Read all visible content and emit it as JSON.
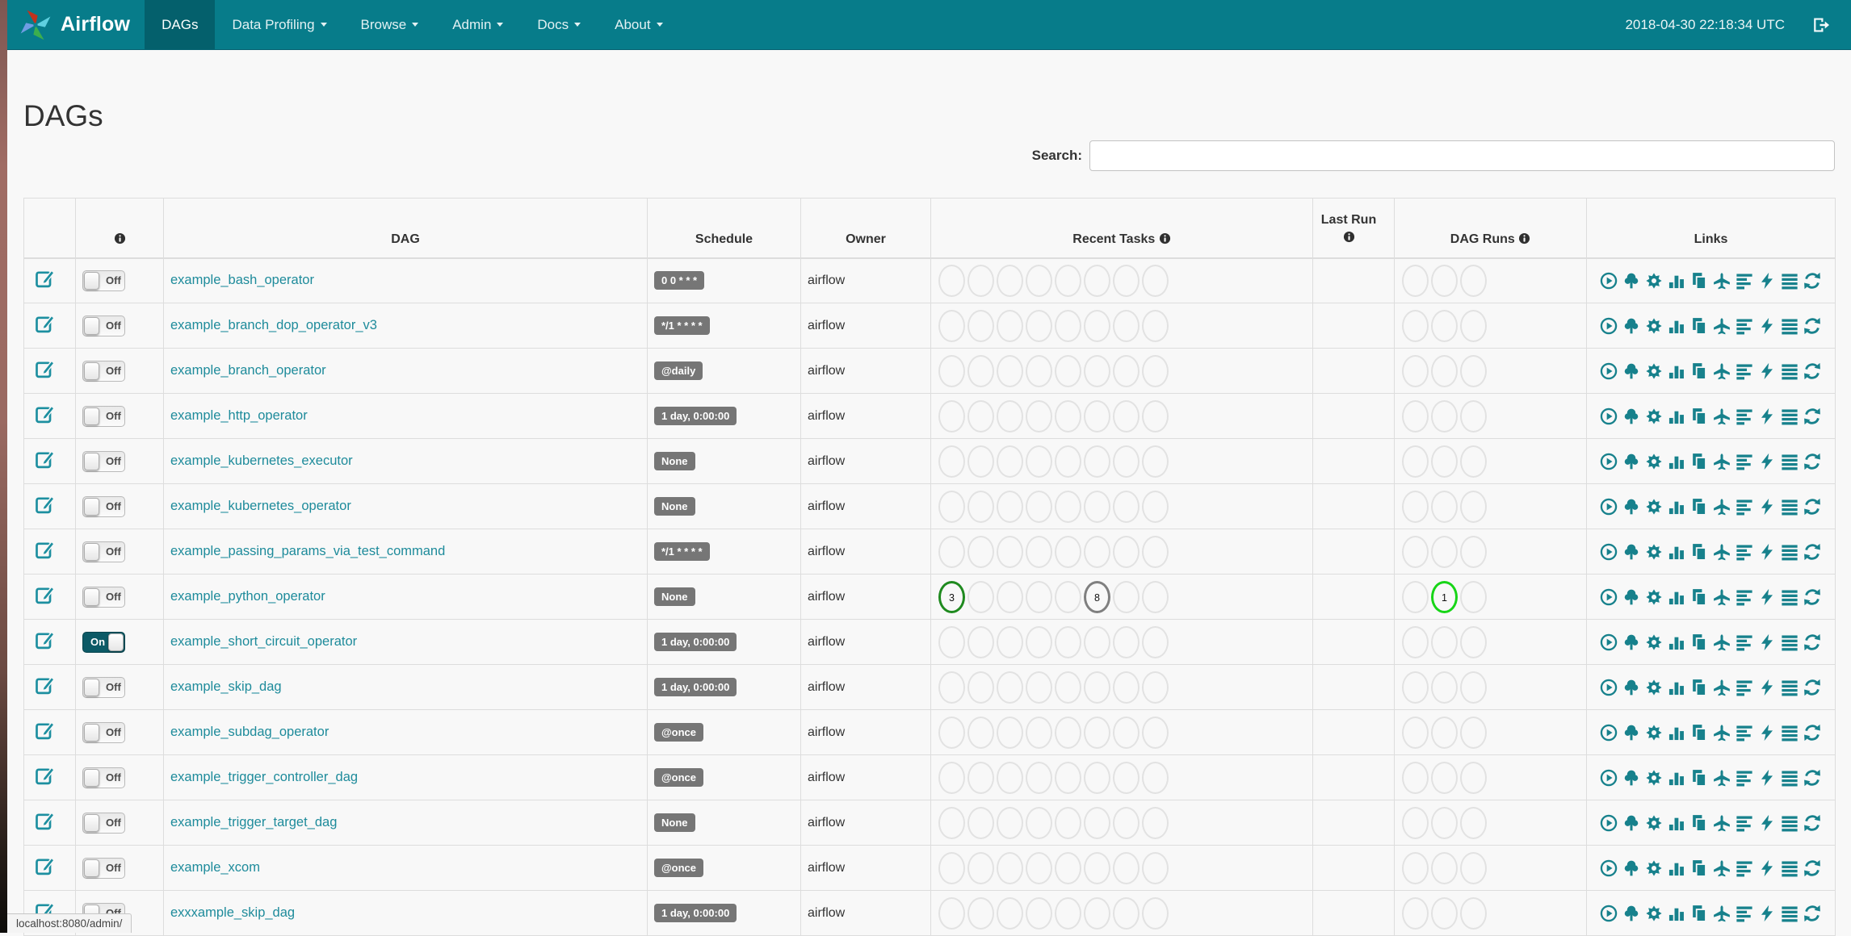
{
  "navbar": {
    "brand": "Airflow",
    "items": [
      {
        "label": "DAGs",
        "active": true,
        "caret": false
      },
      {
        "label": "Data Profiling",
        "active": false,
        "caret": true
      },
      {
        "label": "Browse",
        "active": false,
        "caret": true
      },
      {
        "label": "Admin",
        "active": false,
        "caret": true
      },
      {
        "label": "Docs",
        "active": false,
        "caret": true
      },
      {
        "label": "About",
        "active": false,
        "caret": true
      }
    ],
    "clock": "2018-04-30 22:18:34 UTC"
  },
  "page": {
    "title": "DAGs"
  },
  "search": {
    "label": "Search:",
    "value": "",
    "placeholder": ""
  },
  "table": {
    "headers": {
      "dag": "DAG",
      "schedule": "Schedule",
      "owner": "Owner",
      "recent_tasks": "Recent Tasks",
      "last_run": "Last Run",
      "dag_runs": "DAG Runs",
      "links": "Links"
    },
    "recent_task_slots": 8,
    "dag_run_slots": 3,
    "links": [
      "trigger-dag",
      "tree-view",
      "graph-view",
      "task-duration",
      "task-tries",
      "landing-times",
      "gantt-view",
      "code-view",
      "log-view",
      "refresh"
    ],
    "rows": [
      {
        "dag_id": "example_bash_operator",
        "toggle": "Off",
        "schedule": "0 0 * * *",
        "owner": "airflow",
        "last_run": ""
      },
      {
        "dag_id": "example_branch_dop_operator_v3",
        "toggle": "Off",
        "schedule": "*/1 * * * *",
        "owner": "airflow",
        "last_run": ""
      },
      {
        "dag_id": "example_branch_operator",
        "toggle": "Off",
        "schedule": "@daily",
        "owner": "airflow",
        "last_run": ""
      },
      {
        "dag_id": "example_http_operator",
        "toggle": "Off",
        "schedule": "1 day, 0:00:00",
        "owner": "airflow",
        "last_run": ""
      },
      {
        "dag_id": "example_kubernetes_executor",
        "toggle": "Off",
        "schedule": "None",
        "owner": "airflow",
        "last_run": ""
      },
      {
        "dag_id": "example_kubernetes_operator",
        "toggle": "Off",
        "schedule": "None",
        "owner": "airflow",
        "last_run": ""
      },
      {
        "dag_id": "example_passing_params_via_test_command",
        "toggle": "Off",
        "schedule": "*/1 * * * *",
        "owner": "airflow",
        "last_run": ""
      },
      {
        "dag_id": "example_python_operator",
        "toggle": "Off",
        "schedule": "None",
        "owner": "airflow",
        "last_run": "",
        "recent_tasks": {
          "0": {
            "value": "3",
            "state": "success"
          },
          "5": {
            "value": "8",
            "state": "queued"
          }
        },
        "dag_runs": {
          "1": {
            "value": "1",
            "state": "running"
          }
        }
      },
      {
        "dag_id": "example_short_circuit_operator",
        "toggle": "On",
        "schedule": "1 day, 0:00:00",
        "owner": "airflow",
        "last_run": ""
      },
      {
        "dag_id": "example_skip_dag",
        "toggle": "Off",
        "schedule": "1 day, 0:00:00",
        "owner": "airflow",
        "last_run": ""
      },
      {
        "dag_id": "example_subdag_operator",
        "toggle": "Off",
        "schedule": "@once",
        "owner": "airflow",
        "last_run": ""
      },
      {
        "dag_id": "example_trigger_controller_dag",
        "toggle": "Off",
        "schedule": "@once",
        "owner": "airflow",
        "last_run": ""
      },
      {
        "dag_id": "example_trigger_target_dag",
        "toggle": "Off",
        "schedule": "None",
        "owner": "airflow",
        "last_run": ""
      },
      {
        "dag_id": "example_xcom",
        "toggle": "Off",
        "schedule": "@once",
        "owner": "airflow",
        "last_run": ""
      },
      {
        "dag_id": "exxxample_skip_dag",
        "toggle": "Off",
        "schedule": "1 day, 0:00:00",
        "owner": "airflow",
        "last_run": ""
      }
    ]
  },
  "status_bar": {
    "text": "localhost:8080/admin/"
  },
  "colors": {
    "navbar": "#077c8a",
    "navbar_active": "#04606c",
    "dag_link": "#1e8b9b",
    "icon_accent": "#17818c",
    "badge_bg": "#767676",
    "states": {
      "success": "#1f8a1f",
      "running": "#17d517",
      "queued": "#7f7f7f",
      "none": "#e2e2e2"
    }
  }
}
